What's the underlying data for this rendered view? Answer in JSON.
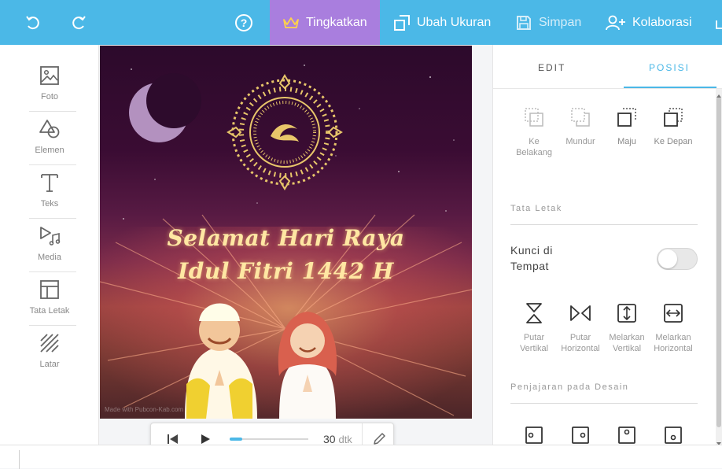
{
  "toolbar": {
    "upgrade_label": "Tingkatkan",
    "resize_label": "Ubah Ukuran",
    "save_label": "Simpan",
    "collab_label": "Kolaborasi",
    "accent_color": "#4bb8e7",
    "upgrade_color": "#a97ede"
  },
  "sidebar": {
    "items": [
      {
        "label": "Foto",
        "icon": "image-icon"
      },
      {
        "label": "Elemen",
        "icon": "shapes-icon"
      },
      {
        "label": "Teks",
        "icon": "text-icon"
      },
      {
        "label": "Media",
        "icon": "media-icon"
      },
      {
        "label": "Tata Letak",
        "icon": "layout-icon"
      },
      {
        "label": "Latar",
        "icon": "background-icon"
      }
    ]
  },
  "design": {
    "greeting_line1": "Selamat Hari Raya",
    "greeting_line2": "Idul Fitri 1442 H",
    "watermark": "Made with Pubcon-Kab.com"
  },
  "player": {
    "duration": "30",
    "unit": "dtk",
    "progress": 0.16
  },
  "panel": {
    "tabs": [
      "EDIT",
      "POSISI"
    ],
    "active_tab": "POSISI",
    "arrange": [
      {
        "label": "Ke Belakang",
        "icon": "send-to-back-icon"
      },
      {
        "label": "Mundur",
        "icon": "send-backward-icon"
      },
      {
        "label": "Maju",
        "icon": "bring-forward-icon"
      },
      {
        "label": "Ke Depan",
        "icon": "bring-to-front-icon"
      }
    ],
    "layout_title": "Tata Letak",
    "lock_label": "Kunci di Tempat",
    "lock_enabled": false,
    "transform": [
      {
        "label": "Putar Vertikal",
        "icon": "flip-vertical-icon"
      },
      {
        "label": "Putar Horizontal",
        "icon": "flip-horizontal-icon"
      },
      {
        "label": "Melarkan Vertikal",
        "icon": "stretch-vertical-icon"
      },
      {
        "label": "Melarkan Horizontal",
        "icon": "stretch-horizontal-icon"
      }
    ],
    "align_title": "Penjajaran pada Desain"
  }
}
